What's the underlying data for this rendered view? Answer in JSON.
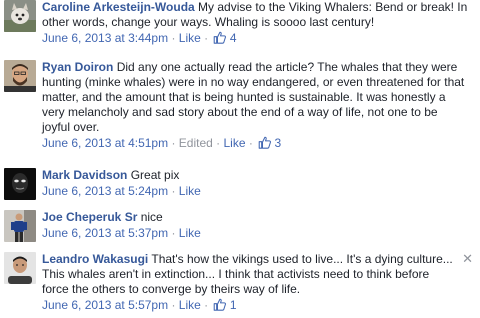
{
  "comments": [
    {
      "author": "Caroline Arkesteijn-Wouda",
      "text": "My advise to the Viking Whalers: Bend or break! In other words, change your ways. Whaling is soooo last century!",
      "timestamp": "June 6, 2013 at 3:44pm",
      "edited": "",
      "like_label": "Like",
      "like_count": "4",
      "avatar": "dog-avatar"
    },
    {
      "author": "Ryan Doiron",
      "text": "Did any one actually read the article? The whales that they were hunting (minke whales) were in no way endangered, or even threatened for that matter, and the amount that is being hunted is sustainable. It was honestly a very melancholy and sad story about the end of a way of life, not one to be joyful over.",
      "timestamp": "June 6, 2013 at 4:51pm",
      "edited": "Edited",
      "like_label": "Like",
      "like_count": "3",
      "avatar": "man-beard-avatar"
    },
    {
      "author": "Mark Davidson",
      "text": "Great pix",
      "timestamp": "June 6, 2013 at 5:24pm",
      "edited": "",
      "like_label": "Like",
      "like_count": "",
      "avatar": "dark-mask-avatar"
    },
    {
      "author": "Joe Cheperuk Sr",
      "text": "nice",
      "timestamp": "June 6, 2013 at 5:37pm",
      "edited": "",
      "like_label": "Like",
      "like_count": "",
      "avatar": "man-standing-avatar"
    },
    {
      "author": "Leandro Wakasugi",
      "text": "That's how the vikings used to live... It's a dying culture... This whales aren't in extinction... I think that activists need to think before force the others to converge by theirs way of life.",
      "timestamp": "June 6, 2013 at 5:57pm",
      "edited": "",
      "like_label": "Like",
      "like_count": "1",
      "avatar": "man-portrait-avatar"
    }
  ],
  "separator": "·",
  "close_glyph": "✕",
  "colors": {
    "author": "#365899",
    "link": "#4267b2",
    "meta": "#90949c",
    "text": "#1d2129"
  }
}
